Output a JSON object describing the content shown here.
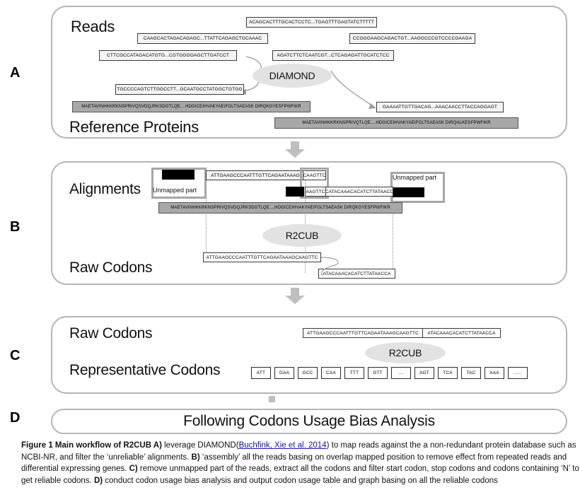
{
  "figure": {
    "panel_letters": [
      "A",
      "B",
      "C",
      "D"
    ],
    "final_banner": "Following Codons Usage Bias Analysis"
  },
  "panelA": {
    "label_reads": "Reads",
    "label_reference": "Reference Proteins",
    "tool": "DIAMOND",
    "reads": [
      "ACAGCACTTTGCACTCCTC...TGAGTTTGAGTATCTTTTT",
      "CAAGCACTAGACAGAGC...TTATTCAGAGCTGCAAAC",
      "CCGGGAAGCAGACTGT...AAGGCCCGTCCCCGAAGA",
      "CTTCGCCATAGACATGTG...CGTGGGGAGCTTGATCCT",
      "AGATCTTCTCAATCGT...CTCAGAGATTGCATCTCC",
      "TGCCCCAGTCTTGGCCTT...GCAATGCCTATGGCTGTGG",
      "GAAAATTGTTGACAG...AAACAACCTTACCAGGAGT"
    ],
    "proteins": [
      "MAETAVINHKKRKNSPRIVQSVDQJRKSDGTLQE....HDGICEIHVAKYAEIFGLTSAEASK DIRQKGYESFPWFIKR",
      "MAETAVINHKKRKNSPRIVQTLQE....HDGICEIHVAKYAEIFGLTSAEASK DIRQALKESFPWFIKR"
    ]
  },
  "panelB": {
    "label_alignments": "Alignments",
    "label_raw_codons": "Raw Codons",
    "tool": "R2CUB",
    "unmapped_label": "Unmapped part",
    "align_read1_main": "ATTGAAGCCCAATTTGTTCAGAATAAAG",
    "align_read1_overlap": "CAAGTTC",
    "align_read2_overlap": "AAGTTC",
    "align_read2_main": "CATACAAACACATCTTATAACC",
    "protein": "MAETAVINHKKRKNSPRIVQSVDQJRKSDGTLQE....HDGICEIHVAKYAEIFGLTSAEASK DIRQKGYESFPWFIKR",
    "raw_codon_read1": "ATTGAAGCCCAATTTGTTCAGAATAAAGCAAGTTC",
    "raw_codon_read2": "ATACAAACACATCTTATAACCA"
  },
  "panelC": {
    "label_raw_codons": "Raw Codons",
    "label_representative": "Representative Codons",
    "tool": "R2CUB",
    "merged_left": "ATTGAAGCCCAATTTGTTCAGAATAAAGCAAGTTC",
    "merged_right": "ATACAAACACATCTTATAACCA",
    "codons": [
      "ATT",
      "GAA",
      "GCC",
      "CAA",
      "TTT",
      "GTT",
      "....",
      "AGT",
      "TCA",
      "TAC",
      "AAA",
      "....."
    ]
  },
  "caption": {
    "bold_lead": "Figure 1 Main workflow of R2CUB A)",
    "part1": " leverage DIAMOND(",
    "citation": "Buchfink, Xie et al. 2014",
    "part2": ") to map reads against the a non-redundant protein database such as NCBI-NR,  and filter the ‘unreliable’ alignments. ",
    "bold_b": "B)",
    "part3": " ‘assembly’ all the reads basing on overlap mapped position to remove effect from repeated reads and differential expressing genes. ",
    "bold_c": "C)",
    "part4": " remove unmapped part of the reads, extract all the codons and filter start codon, stop codons and codons containing ‘N’ to get reliable codons. ",
    "bold_d": "D)",
    "part5": " conduct codon usage bias analysis and output codon usage table and graph basing on all the reliable codons"
  },
  "colors": {
    "panel_border": "#b5b5b5",
    "protein_fill": "#a8a8a8",
    "ellipse_fill": "#e2e2e2",
    "arrow_gray": "#bfbfbf",
    "citation_blue": "#1414a0"
  }
}
